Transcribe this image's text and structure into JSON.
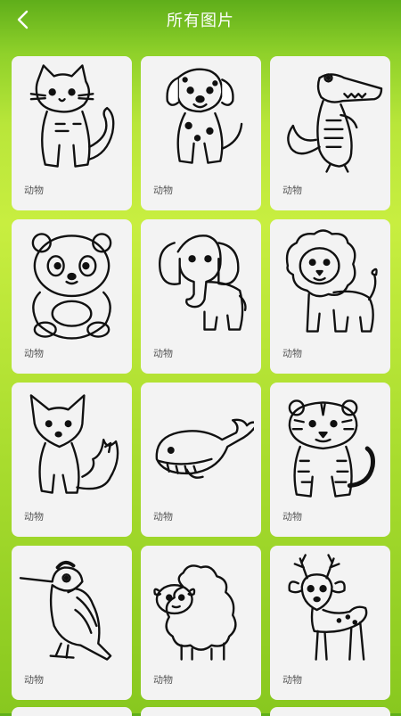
{
  "header": {
    "title": "所有图片",
    "back_icon": "back-arrow-icon"
  },
  "cards": [
    {
      "category": "动物",
      "subject": "cat-drawing"
    },
    {
      "category": "动物",
      "subject": "dalmatian-dog-drawing"
    },
    {
      "category": "动物",
      "subject": "crocodile-drawing"
    },
    {
      "category": "动物",
      "subject": "panda-drawing"
    },
    {
      "category": "动物",
      "subject": "elephant-drawing"
    },
    {
      "category": "动物",
      "subject": "lion-drawing"
    },
    {
      "category": "动物",
      "subject": "fox-drawing"
    },
    {
      "category": "动物",
      "subject": "whale-drawing"
    },
    {
      "category": "动物",
      "subject": "tiger-drawing"
    },
    {
      "category": "动物",
      "subject": "woodpecker-drawing"
    },
    {
      "category": "动物",
      "subject": "sheep-drawing"
    },
    {
      "category": "动物",
      "subject": "deer-drawing"
    }
  ],
  "colors": {
    "accent": "#8fd12a",
    "card_bg": "#f3f3f3",
    "line": "#111111"
  }
}
